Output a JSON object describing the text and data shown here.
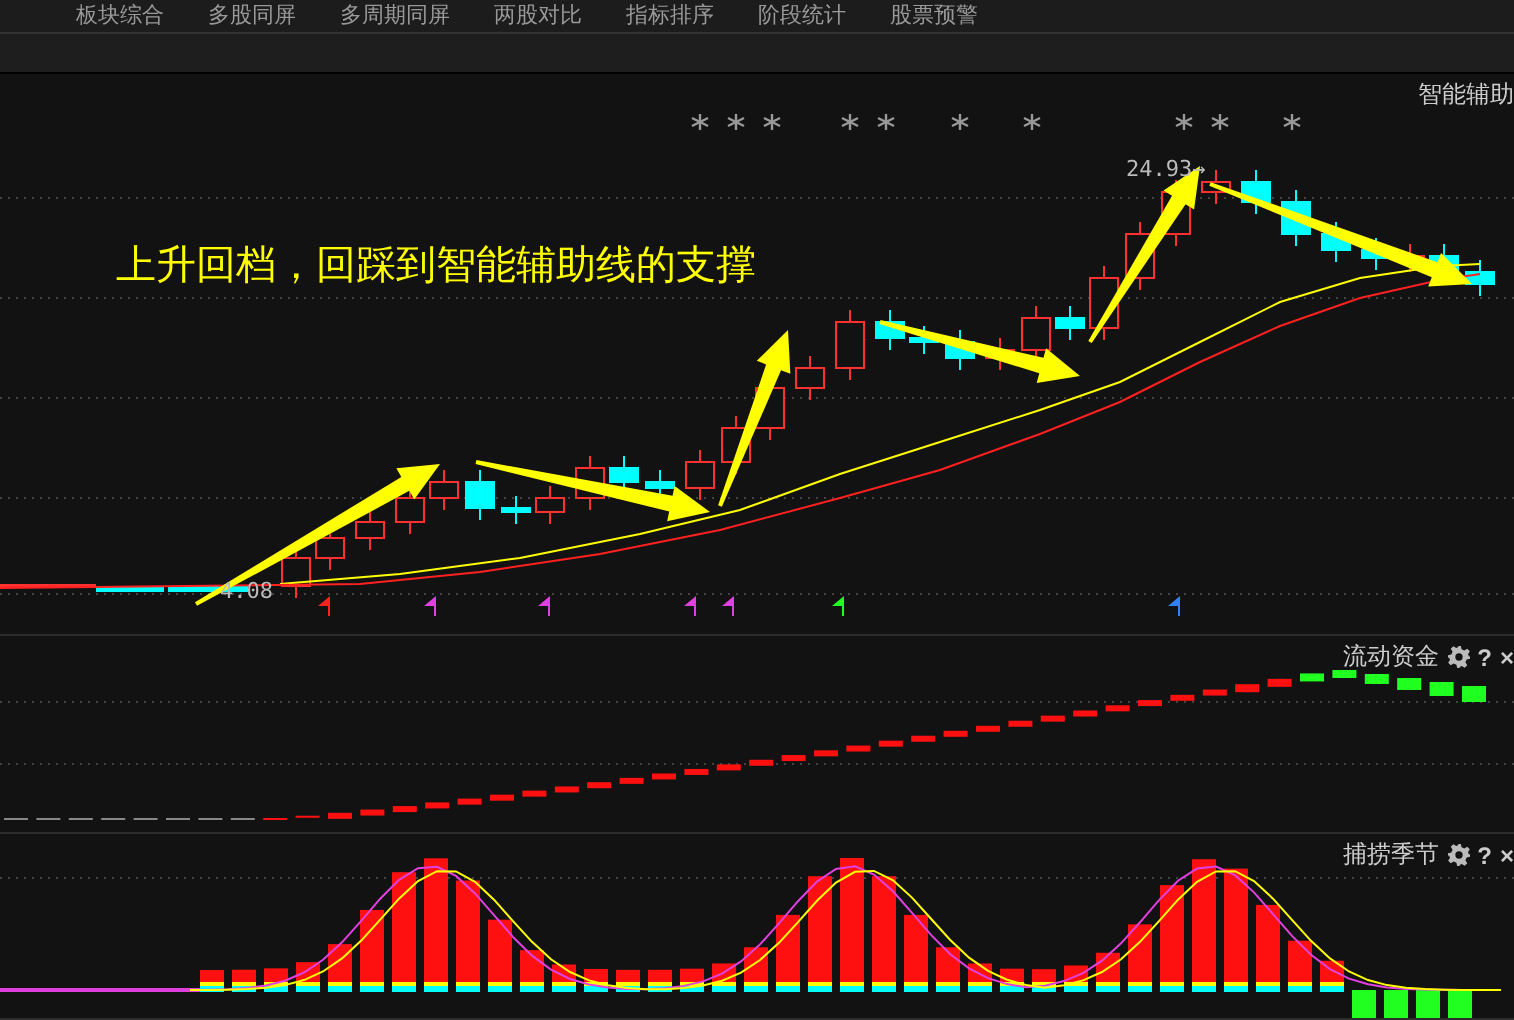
{
  "tabs": [
    {
      "label": "板块综合",
      "selected": false
    },
    {
      "label": "多股同屏",
      "selected": false
    },
    {
      "label": "多周期同屏",
      "selected": false
    },
    {
      "label": "两股对比",
      "selected": false
    },
    {
      "label": "指标排序",
      "selected": false
    },
    {
      "label": "阶段统计",
      "selected": false
    },
    {
      "label": "股票预警",
      "selected": false
    }
  ],
  "main_panel": {
    "title": "智能辅助",
    "annotation": "上升回档，回踩到智能辅助线的支撑",
    "high_label": "24.93→",
    "low_label": "4.08"
  },
  "indicator_panels": [
    {
      "title": "流动资金",
      "help": "?",
      "close": "×"
    },
    {
      "title": "捕捞季节",
      "help": "?",
      "close": "×"
    }
  ]
}
